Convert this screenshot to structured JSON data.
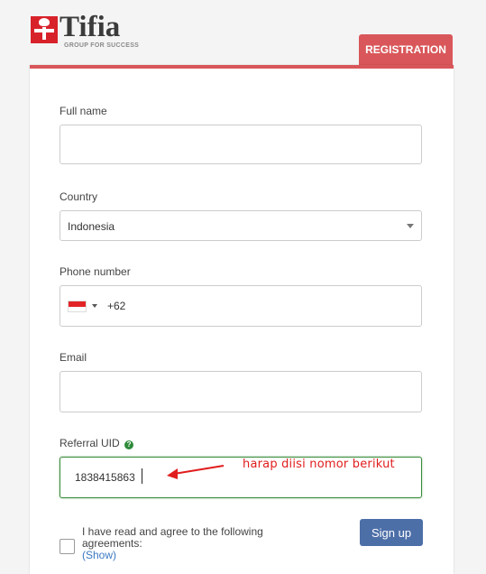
{
  "brand": {
    "name": "Tifia",
    "tagline": "GROUP FOR SUCCESS",
    "accent_color": "#d9575a"
  },
  "tab": {
    "label": "REGISTRATION"
  },
  "form": {
    "full_name": {
      "label": "Full name",
      "value": ""
    },
    "country": {
      "label": "Country",
      "value": "Indonesia"
    },
    "phone": {
      "label": "Phone number",
      "flag": "indonesia-flag",
      "dial_code": "+62"
    },
    "email": {
      "label": "Email",
      "value": ""
    },
    "referral": {
      "label": "Referral UID",
      "help_icon": "question-circle-icon",
      "value": "1838415863"
    },
    "agreement": {
      "text": "I have read and agree to the following agreements:",
      "show_link": "(Show)",
      "checked": false
    },
    "submit_label": "Sign up"
  },
  "annotation": {
    "text": "harap diisi nomor berikut",
    "color": "#e11d1d"
  }
}
